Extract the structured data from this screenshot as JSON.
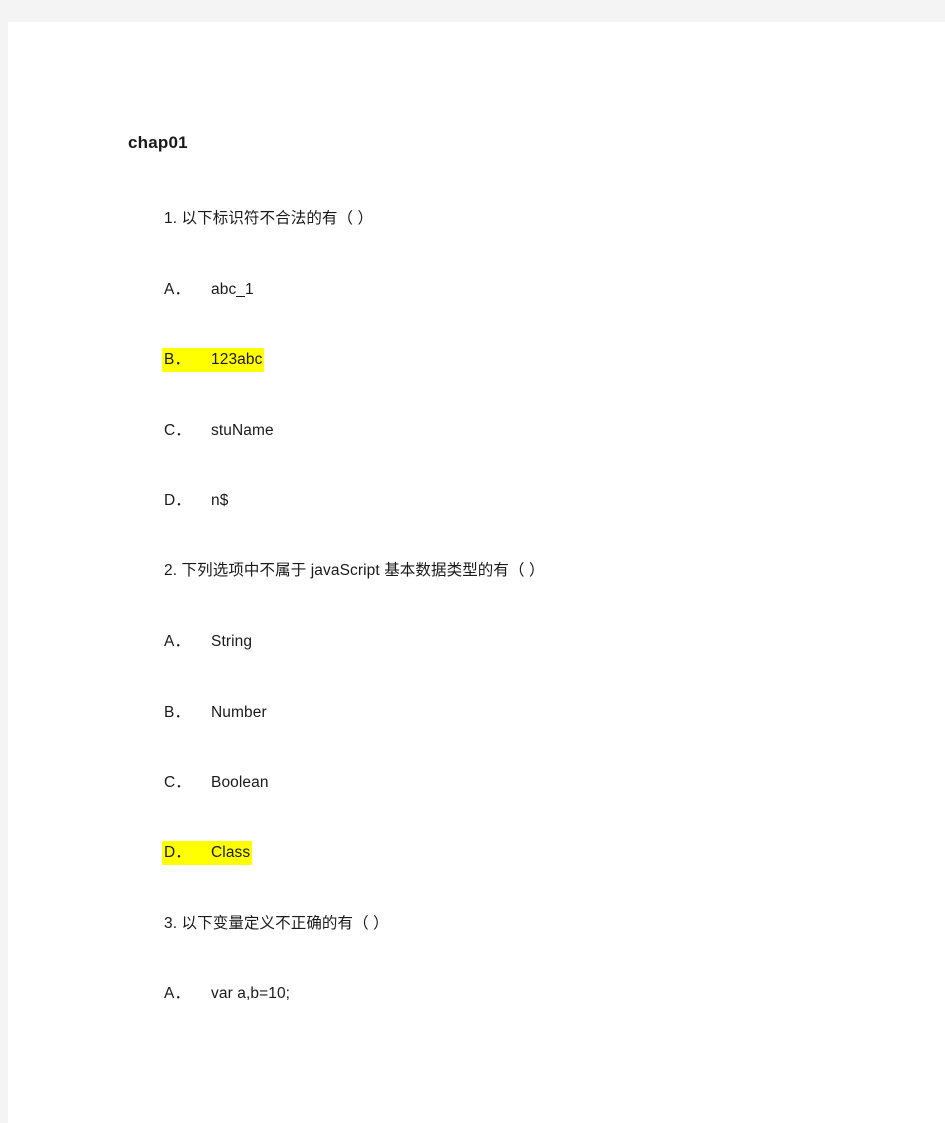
{
  "document": {
    "title": "chap01",
    "background_color": "#ffffff",
    "page_margin_color": "#f4f4f4",
    "highlight_color": "#ffff00",
    "text_color": "#1a1a1a"
  },
  "questions": [
    {
      "number": "1.",
      "prompt": "1. 以下标识符不合法的有（ ）",
      "options": [
        {
          "letter": "A．",
          "text": "abc_1",
          "highlighted": false
        },
        {
          "letter": "B．",
          "text": "123abc",
          "highlighted": true
        },
        {
          "letter": "C．",
          "text": "stuName",
          "highlighted": false
        },
        {
          "letter": "D．",
          "text": "n$",
          "highlighted": false
        }
      ]
    },
    {
      "number": "2.",
      "prompt": "2. 下列选项中不属于 javaScript 基本数据类型的有（ ）",
      "options": [
        {
          "letter": "A．",
          "text": "String",
          "highlighted": false
        },
        {
          "letter": "B．",
          "text": "Number",
          "highlighted": false
        },
        {
          "letter": "C．",
          "text": "Boolean",
          "highlighted": false
        },
        {
          "letter": "D．",
          "text": "Class",
          "highlighted": true
        }
      ]
    },
    {
      "number": "3.",
      "prompt": "3. 以下变量定义不正确的有（ ）",
      "options": [
        {
          "letter": "A．",
          "text": "var a,b=10;",
          "highlighted": false
        }
      ]
    }
  ]
}
